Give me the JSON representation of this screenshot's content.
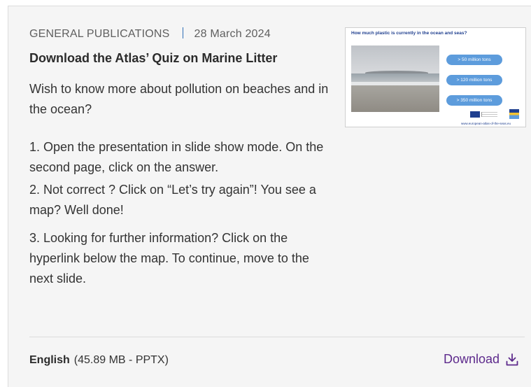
{
  "publication": {
    "category": "GENERAL PUBLICATIONS",
    "date": "28 March 2024",
    "title": "Download the Atlas’ Quiz on Marine Litter",
    "paragraphs": [
      "Wish to know more about pollution on beaches and in the ocean?",
      "1. Open the presentation in slide show mode. On the second page, click on the answer.",
      "2. Not correct ? Click on “Let’s try again”! You see a map? Well done!",
      "3. Looking for further information? Click on the hyperlink below the map. To continue, move to the next slide."
    ]
  },
  "thumbnail": {
    "question": "How much plastic is currently in the ocean and seas?",
    "answers": [
      "> 50 million tons",
      "> 120 million tons",
      "> 350 million tons"
    ],
    "url": "www.european-atlas-of-the-seas.eu",
    "answer_color": "#5d9cdc"
  },
  "footer": {
    "language": "English",
    "file_info": "(45.89 MB - PPTX)",
    "download_label": "Download",
    "download_icon": "download-icon",
    "link_color": "#5d2a8c"
  }
}
